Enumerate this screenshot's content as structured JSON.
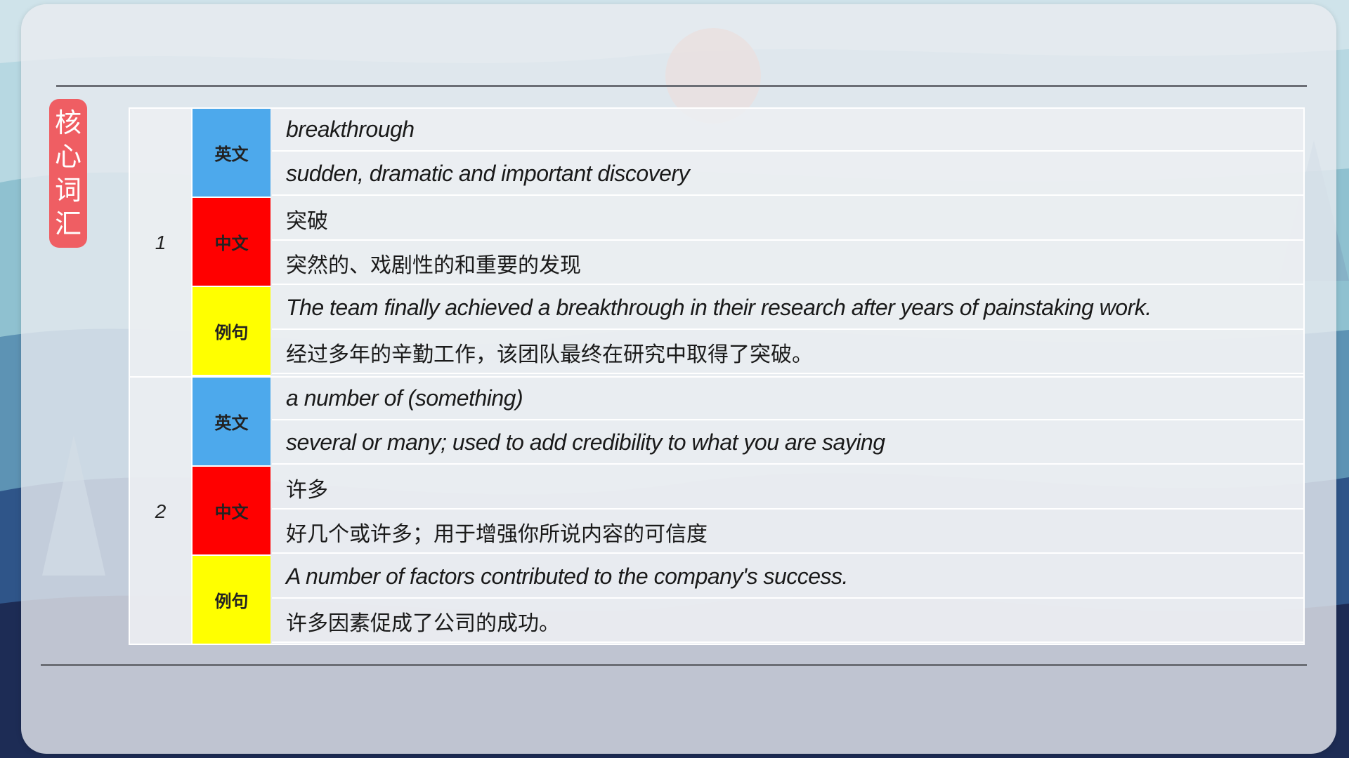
{
  "side_tag": {
    "chars": [
      "核",
      "心",
      "词",
      "汇"
    ]
  },
  "colors": {
    "english_tag": "#4da9ec",
    "chinese_tag": "#ff0000",
    "example_tag": "#ffff00",
    "side_tag": "#ef5e63"
  },
  "entries": [
    {
      "number": "1",
      "english_label": "英文",
      "english_word": "breakthrough",
      "english_definition": "sudden, dramatic and important discovery",
      "chinese_label": "中文",
      "chinese_word": "突破",
      "chinese_definition": "突然的、戏剧性的和重要的发现",
      "example_label": "例句",
      "example_english": "The team finally achieved a breakthrough in their research after years of painstaking work.",
      "example_chinese": "经过多年的辛勤工作，该团队最终在研究中取得了突破。"
    },
    {
      "number": "2",
      "english_label": "英文",
      "english_word": "a number of (something)",
      "english_definition": "several or many; used to add credibility to what you are saying",
      "chinese_label": "中文",
      "chinese_word": "许多",
      "chinese_definition": "好几个或许多；用于增强你所说内容的可信度",
      "example_label": "例句",
      "example_english": "A number of factors contributed to the company's success.",
      "example_chinese": "许多因素促成了公司的成功。"
    }
  ]
}
